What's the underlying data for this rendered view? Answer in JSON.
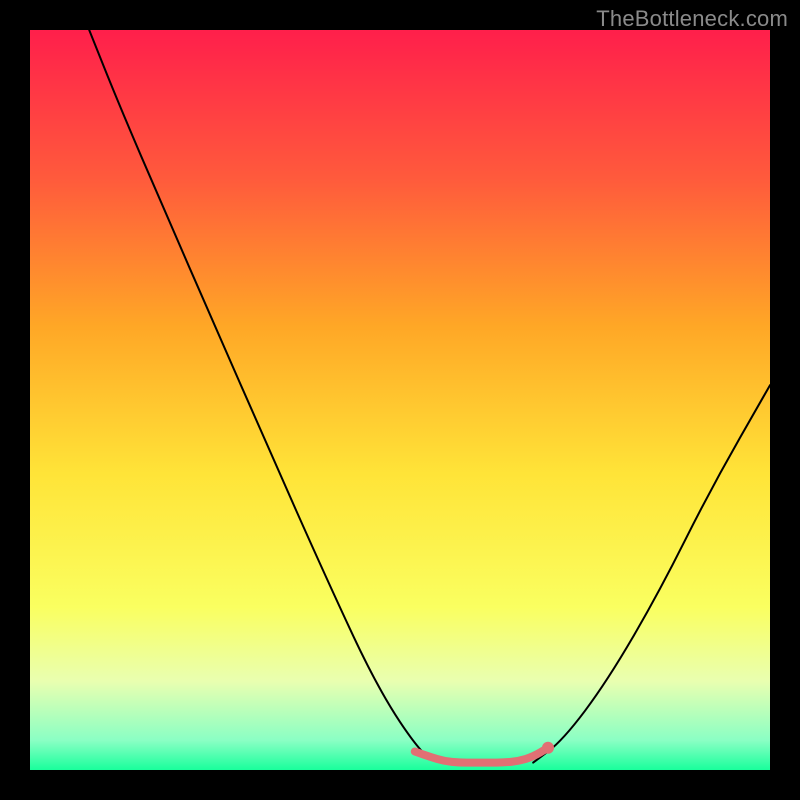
{
  "watermark": "TheBottleneck.com",
  "chart_data": {
    "type": "line",
    "title": "",
    "xlabel": "",
    "ylabel": "",
    "xlim": [
      0,
      100
    ],
    "ylim": [
      0,
      100
    ],
    "grid": false,
    "background_gradient_stops": [
      {
        "offset": 0,
        "color": "#ff1f4b"
      },
      {
        "offset": 20,
        "color": "#ff5a3c"
      },
      {
        "offset": 40,
        "color": "#ffa726"
      },
      {
        "offset": 60,
        "color": "#ffe438"
      },
      {
        "offset": 78,
        "color": "#faff60"
      },
      {
        "offset": 88,
        "color": "#e9ffb0"
      },
      {
        "offset": 96,
        "color": "#8affc4"
      },
      {
        "offset": 100,
        "color": "#19ff9c"
      }
    ],
    "series": [
      {
        "name": "left-curve",
        "color": "#000000",
        "x": [
          8,
          12,
          18,
          25,
          32,
          40,
          47,
          53,
          55.5
        ],
        "y": [
          100,
          90,
          76,
          60,
          44,
          26,
          11,
          2,
          1
        ]
      },
      {
        "name": "right-curve",
        "color": "#000000",
        "x": [
          68,
          72,
          78,
          85,
          92,
          100
        ],
        "y": [
          1,
          4,
          12,
          24,
          38,
          52
        ]
      },
      {
        "name": "bottom-pink-segment",
        "color": "#e17074",
        "x": [
          52,
          54,
          56,
          58,
          60,
          62,
          64,
          66,
          68,
          70
        ],
        "y": [
          2.5,
          1.8,
          1.2,
          1.0,
          1.0,
          1.0,
          1.0,
          1.2,
          1.8,
          3.0
        ]
      }
    ],
    "annotations": {
      "pink_endpoint_marker": {
        "x": 70,
        "y": 3.0,
        "color": "#e17074",
        "radius": 3
      }
    }
  }
}
